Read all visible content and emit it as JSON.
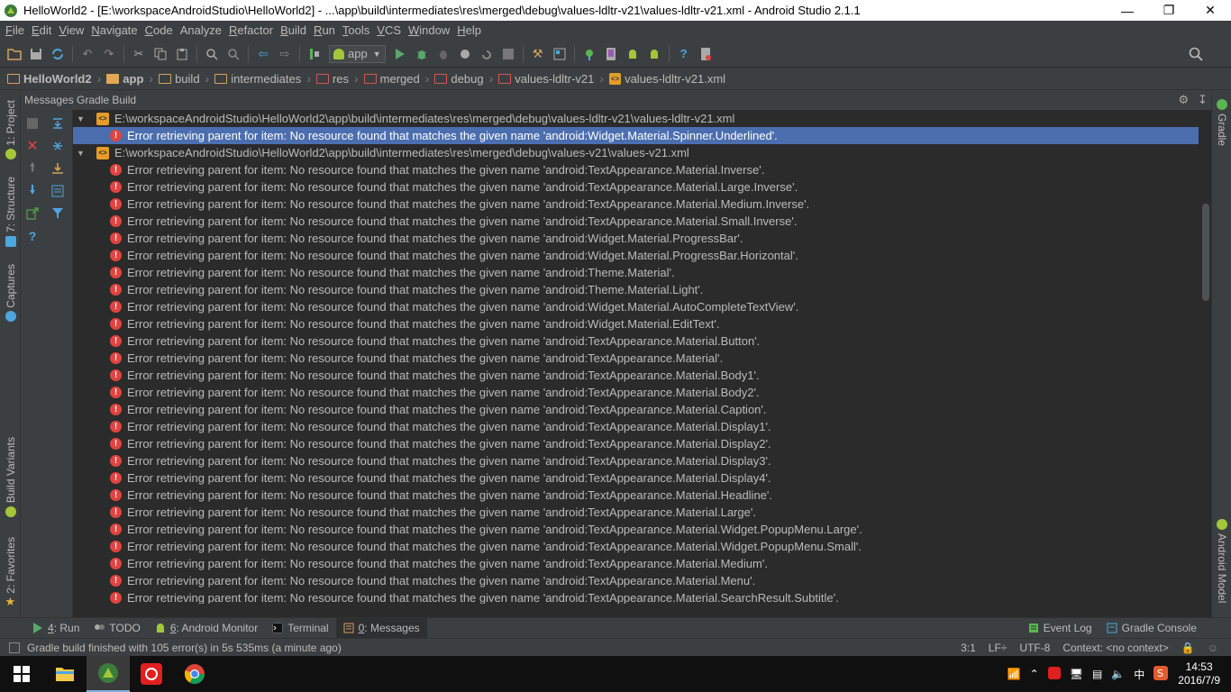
{
  "window": {
    "title": "HelloWorld2 - [E:\\workspaceAndroidStudio\\HelloWorld2] - ...\\app\\build\\intermediates\\res\\merged\\debug\\values-ldltr-v21\\values-ldltr-v21.xml - Android Studio 2.1.1"
  },
  "menu": [
    {
      "u": "F",
      "rest": "ile"
    },
    {
      "u": "E",
      "rest": "dit"
    },
    {
      "u": "V",
      "rest": "iew"
    },
    {
      "u": "N",
      "rest": "avigate"
    },
    {
      "u": "C",
      "rest": "ode"
    },
    {
      "u": "",
      "rest": "Analyze"
    },
    {
      "u": "R",
      "rest": "efactor"
    },
    {
      "u": "B",
      "rest": "uild"
    },
    {
      "u": "R",
      "rest": "un"
    },
    {
      "u": "T",
      "rest": "ools"
    },
    {
      "u": "V",
      "rest": "CS"
    },
    {
      "u": "W",
      "rest": "indow"
    },
    {
      "u": "H",
      "rest": "elp"
    }
  ],
  "toolbar": {
    "run_config": "app"
  },
  "breadcrumbs": [
    "HelloWorld2",
    "app",
    "build",
    "intermediates",
    "res",
    "merged",
    "debug",
    "values-ldltr-v21",
    "values-ldltr-v21.xml"
  ],
  "left_tabs": {
    "project": "1: Project",
    "structure": "7: Structure",
    "captures": "Captures",
    "build_variants": "Build Variants",
    "favorites": "2: Favorites"
  },
  "right_tabs": {
    "gradle": "Gradle",
    "android_model": "Android Model"
  },
  "panel": {
    "title": "Messages Gradle Build"
  },
  "messages": {
    "file1": "E:\\workspaceAndroidStudio\\HelloWorld2\\app\\build\\intermediates\\res\\merged\\debug\\values-ldltr-v21\\values-ldltr-v21.xml",
    "file1_error": "Error retrieving parent for item: No resource found that matches the given name 'android:Widget.Material.Spinner.Underlined'.",
    "file2": "E:\\workspaceAndroidStudio\\HelloWorld2\\app\\build\\intermediates\\res\\merged\\debug\\values-v21\\values-v21.xml",
    "file2_errors": [
      "Error retrieving parent for item: No resource found that matches the given name 'android:TextAppearance.Material.Inverse'.",
      "Error retrieving parent for item: No resource found that matches the given name 'android:TextAppearance.Material.Large.Inverse'.",
      "Error retrieving parent for item: No resource found that matches the given name 'android:TextAppearance.Material.Medium.Inverse'.",
      "Error retrieving parent for item: No resource found that matches the given name 'android:TextAppearance.Material.Small.Inverse'.",
      "Error retrieving parent for item: No resource found that matches the given name 'android:Widget.Material.ProgressBar'.",
      "Error retrieving parent for item: No resource found that matches the given name 'android:Widget.Material.ProgressBar.Horizontal'.",
      "Error retrieving parent for item: No resource found that matches the given name 'android:Theme.Material'.",
      "Error retrieving parent for item: No resource found that matches the given name 'android:Theme.Material.Light'.",
      "Error retrieving parent for item: No resource found that matches the given name 'android:Widget.Material.AutoCompleteTextView'.",
      "Error retrieving parent for item: No resource found that matches the given name 'android:Widget.Material.EditText'.",
      "Error retrieving parent for item: No resource found that matches the given name 'android:TextAppearance.Material.Button'.",
      "Error retrieving parent for item: No resource found that matches the given name 'android:TextAppearance.Material'.",
      "Error retrieving parent for item: No resource found that matches the given name 'android:TextAppearance.Material.Body1'.",
      "Error retrieving parent for item: No resource found that matches the given name 'android:TextAppearance.Material.Body2'.",
      "Error retrieving parent for item: No resource found that matches the given name 'android:TextAppearance.Material.Caption'.",
      "Error retrieving parent for item: No resource found that matches the given name 'android:TextAppearance.Material.Display1'.",
      "Error retrieving parent for item: No resource found that matches the given name 'android:TextAppearance.Material.Display2'.",
      "Error retrieving parent for item: No resource found that matches the given name 'android:TextAppearance.Material.Display3'.",
      "Error retrieving parent for item: No resource found that matches the given name 'android:TextAppearance.Material.Display4'.",
      "Error retrieving parent for item: No resource found that matches the given name 'android:TextAppearance.Material.Headline'.",
      "Error retrieving parent for item: No resource found that matches the given name 'android:TextAppearance.Material.Large'.",
      "Error retrieving parent for item: No resource found that matches the given name 'android:TextAppearance.Material.Widget.PopupMenu.Large'.",
      "Error retrieving parent for item: No resource found that matches the given name 'android:TextAppearance.Material.Widget.PopupMenu.Small'.",
      "Error retrieving parent for item: No resource found that matches the given name 'android:TextAppearance.Material.Medium'.",
      "Error retrieving parent for item: No resource found that matches the given name 'android:TextAppearance.Material.Menu'.",
      "Error retrieving parent for item: No resource found that matches the given name 'android:TextAppearance.Material.SearchResult.Subtitle'."
    ]
  },
  "bottom_tabs": {
    "run": {
      "u": "4",
      "rest": ": Run"
    },
    "todo": {
      "u": "",
      "rest": "TODO"
    },
    "monitor": {
      "u": "6",
      "rest": ": Android Monitor"
    },
    "terminal": {
      "u": "",
      "rest": "Terminal"
    },
    "messages": {
      "u": "0",
      "rest": ": Messages"
    },
    "event_log": {
      "u": "",
      "rest": "Event Log"
    },
    "gradle_console": {
      "u": "",
      "rest": "Gradle Console"
    }
  },
  "status": {
    "message": "Gradle build finished with 105 error(s) in 5s 535ms (a minute ago)",
    "position": "3:1",
    "line_sep": "LF÷",
    "encoding": "UTF-8",
    "context": "Context: <no context>"
  },
  "taskbar": {
    "time": "14:53",
    "date": "2016/7/9",
    "ime": "中"
  },
  "colors": {
    "error_red": "#e0443e",
    "selection_blue": "#4b6eaf",
    "android_green": "#a4c639"
  }
}
